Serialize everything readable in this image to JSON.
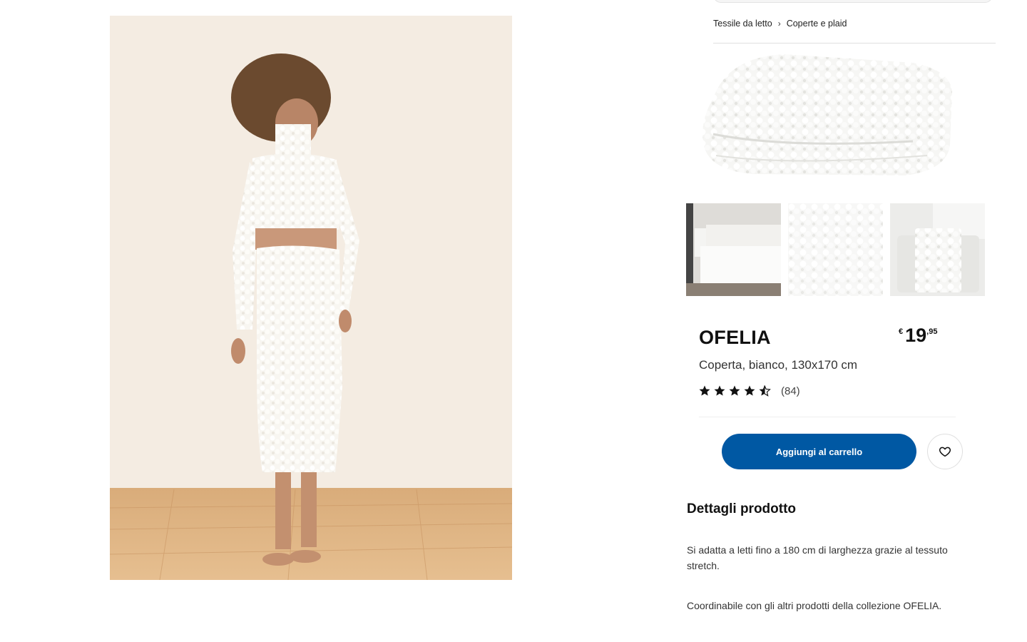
{
  "breadcrumb": {
    "items": [
      "Tessile da letto",
      "Coperte e plaid"
    ],
    "separator": "›"
  },
  "product": {
    "name": "OFELIA",
    "description": "Coperta, bianco, 130x170 cm",
    "price": {
      "currency": "€",
      "integer": "19",
      "decimal": ",95"
    },
    "rating": {
      "value": 4.5,
      "max": 5,
      "review_count": "(84)"
    }
  },
  "actions": {
    "add_to_cart_label": "Aggiungi al carrello",
    "favourite_icon": "heart-icon"
  },
  "details": {
    "title": "Dettagli prodotto",
    "paragraphs": [
      "Si adatta a letti fino a 180 cm di larghezza grazie al tessuto stretch.",
      "Coordinabile con gli altri prodotti della collezione OFELIA."
    ]
  },
  "colors": {
    "primary_button": "#0058a3",
    "text": "#111111"
  },
  "images": {
    "model_photo": "woman in white textured crop top and skirt",
    "main_product": "folded white fluffy blanket",
    "thumbnails": [
      "bedroom with white blanket on bed",
      "close-up of blanket texture",
      "blanket draped over bench"
    ]
  }
}
